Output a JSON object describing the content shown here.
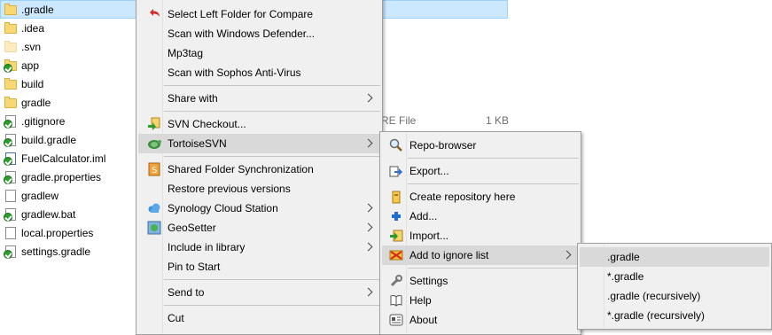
{
  "files": [
    {
      "name": ".gradle",
      "icon": "folder",
      "selected": true
    },
    {
      "name": ".idea",
      "icon": "folder"
    },
    {
      "name": ".svn",
      "icon": "folder-faded"
    },
    {
      "name": "app",
      "icon": "folder-svn-ok"
    },
    {
      "name": "build",
      "icon": "folder"
    },
    {
      "name": "gradle",
      "icon": "folder"
    },
    {
      "name": ".gitignore",
      "icon": "file-svn-ok"
    },
    {
      "name": "build.gradle",
      "icon": "file-svn-ok"
    },
    {
      "name": "FuelCalculator.iml",
      "icon": "file-svn-ok"
    },
    {
      "name": "gradle.properties",
      "icon": "file-svn-ok"
    },
    {
      "name": "gradlew",
      "icon": "file"
    },
    {
      "name": "gradlew.bat",
      "icon": "file-svn-ok"
    },
    {
      "name": "local.properties",
      "icon": "file"
    },
    {
      "name": "settings.gradle",
      "icon": "file-svn-ok"
    }
  ],
  "background_text": {
    "type_fragment": "RE File",
    "size": "1 KB"
  },
  "context_menu": {
    "items": [
      {
        "label": "Select Left Folder for Compare",
        "icon": "undo-arrow-icon"
      },
      {
        "label": "Scan with Windows Defender..."
      },
      {
        "label": "Mp3tag"
      },
      {
        "label": "Scan with Sophos Anti-Virus"
      },
      {
        "label": "Share with",
        "submenu": true
      },
      {
        "label": "SVN Checkout...",
        "icon": "svn-checkout-icon"
      },
      {
        "label": "TortoiseSVN",
        "icon": "tortoisesvn-icon",
        "submenu": true,
        "highlighted": true
      },
      {
        "label": "Shared Folder Synchronization",
        "icon": "sync-icon"
      },
      {
        "label": "Restore previous versions"
      },
      {
        "label": "Synology Cloud Station",
        "icon": "cloud-station-icon",
        "submenu": true
      },
      {
        "label": "GeoSetter",
        "icon": "geosetter-icon",
        "submenu": true
      },
      {
        "label": "Include in library",
        "submenu": true
      },
      {
        "label": "Pin to Start"
      },
      {
        "label": "Send to",
        "submenu": true
      },
      {
        "label": "Cut"
      }
    ]
  },
  "tortoise_menu": {
    "items": [
      {
        "label": "Repo-browser",
        "icon": "magnifier-icon"
      },
      {
        "label": "Export...",
        "icon": "export-icon"
      },
      {
        "label": "Create repository here",
        "icon": "create-repo-icon"
      },
      {
        "label": "Add...",
        "icon": "add-plus-icon"
      },
      {
        "label": "Import...",
        "icon": "import-icon"
      },
      {
        "label": "Add to ignore list",
        "icon": "ignore-list-icon",
        "submenu": true,
        "highlighted": true
      },
      {
        "label": "Settings",
        "icon": "wrench-icon"
      },
      {
        "label": "Help",
        "icon": "help-icon"
      },
      {
        "label": "About",
        "icon": "about-icon"
      }
    ]
  },
  "ignore_menu": {
    "items": [
      {
        "label": ".gradle",
        "highlighted": true
      },
      {
        "label": "*.gradle"
      },
      {
        "label": ".gradle (recursively)"
      },
      {
        "label": "*.gradle (recursively)"
      }
    ]
  }
}
